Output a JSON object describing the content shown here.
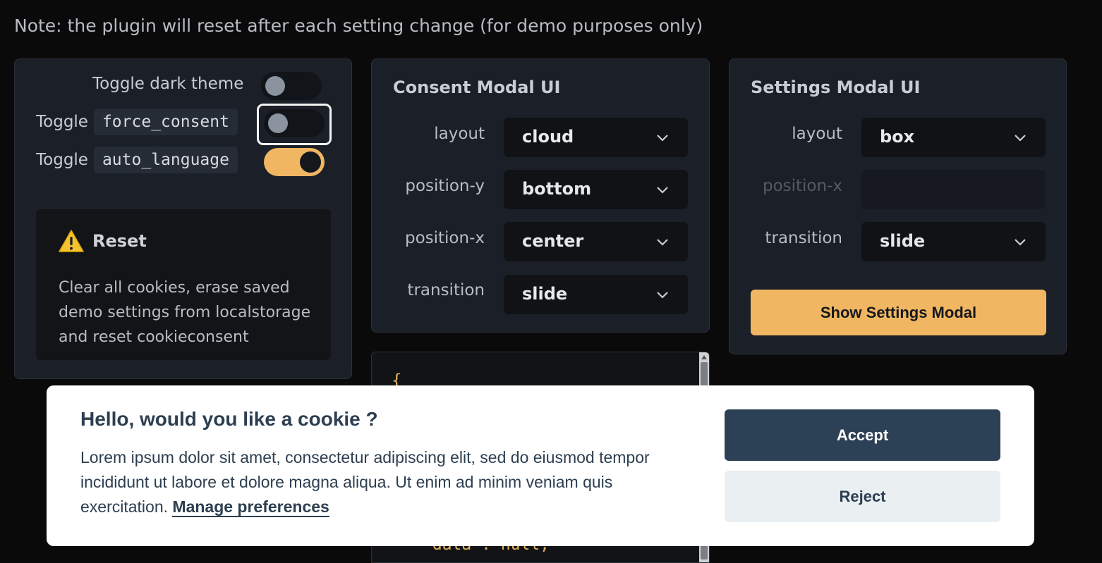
{
  "note": "Note: the plugin will reset after each setting change (for demo purposes only)",
  "toggles": {
    "dark_theme": {
      "label": "Toggle dark theme",
      "on": false
    },
    "force_consent": {
      "prefix": "Toggle",
      "code": "force_consent",
      "on": false
    },
    "auto_language": {
      "prefix": "Toggle",
      "code": "auto_language",
      "on": true
    }
  },
  "reset": {
    "title": "Reset",
    "description": "Clear all cookies, erase saved demo settings from localstorage and reset cookieconsent"
  },
  "consent_ui": {
    "title": "Consent Modal UI",
    "fields": [
      {
        "label": "layout",
        "value": "cloud"
      },
      {
        "label": "position-y",
        "value": "bottom"
      },
      {
        "label": "position-x",
        "value": "center"
      },
      {
        "label": "transition",
        "value": "slide"
      }
    ]
  },
  "settings_ui": {
    "title": "Settings Modal UI",
    "fields": [
      {
        "label": "layout",
        "value": "box"
      },
      {
        "label": "position-x",
        "value": ""
      },
      {
        "label": "transition",
        "value": "slide"
      }
    ],
    "button": "Show Settings Modal"
  },
  "code": {
    "open_brace": "{",
    "partial_line": "\"data\": null,"
  },
  "cookie_modal": {
    "title": "Hello, would you like a cookie ?",
    "description": "Lorem ipsum dolor sit amet, consectetur adipiscing elit, sed do eiusmod tempor incididunt ut labore et dolore magna aliqua. Ut enim ad minim veniam quis exercitation.",
    "link": "Manage preferences",
    "accept": "Accept",
    "reject": "Reject"
  },
  "colors": {
    "accent": "#f0b661",
    "modal_primary": "#2d4156",
    "modal_text": "#2c3e50"
  }
}
